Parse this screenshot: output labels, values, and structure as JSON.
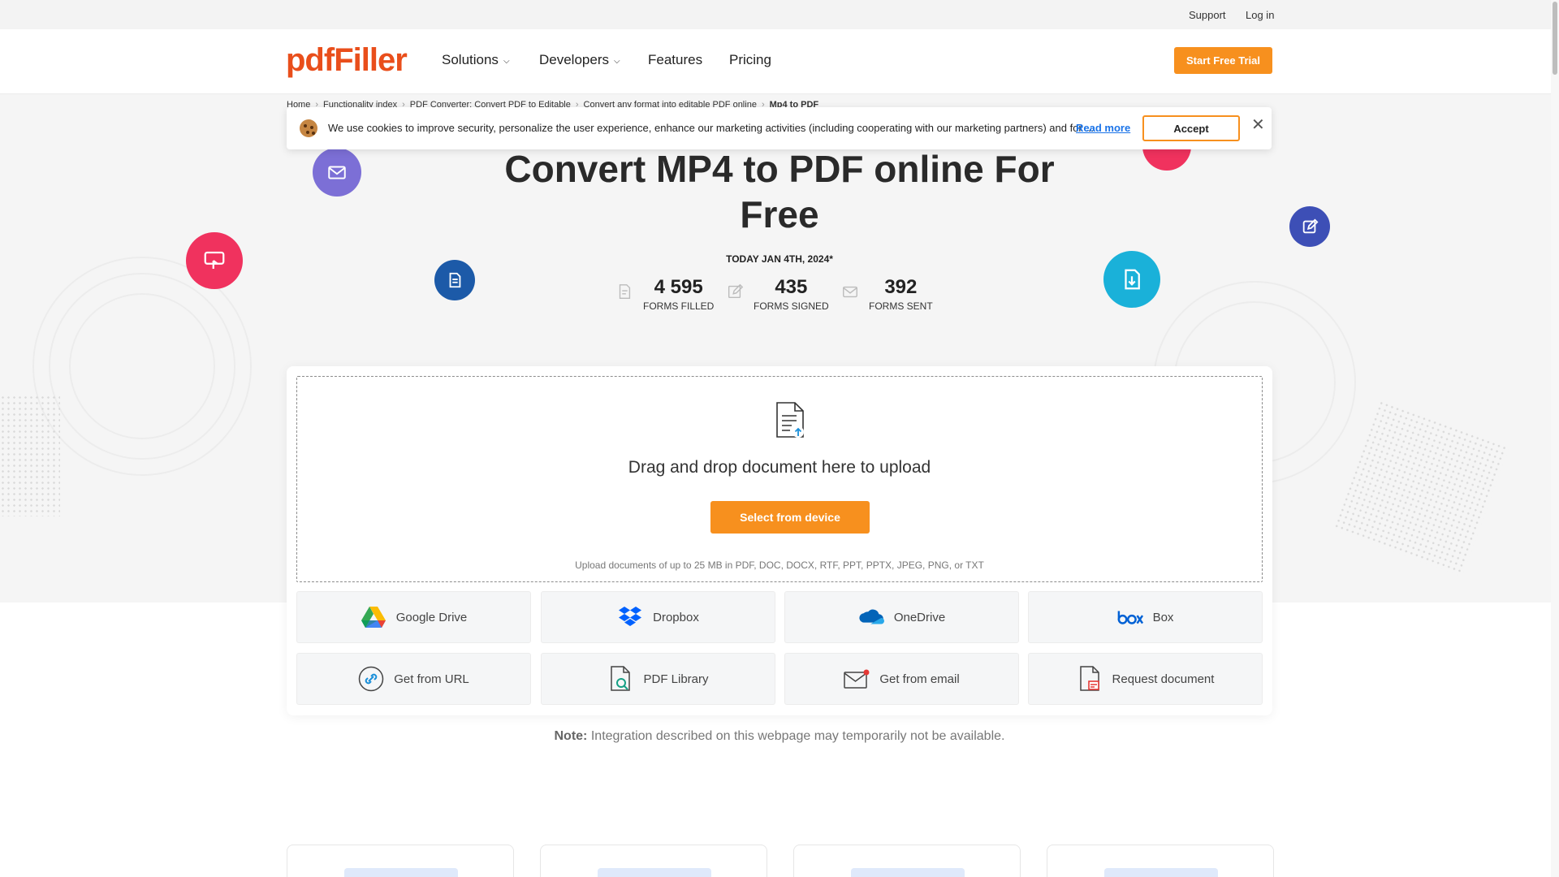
{
  "utility": {
    "support": "Support",
    "login": "Log in"
  },
  "header": {
    "logo": "pdfFiller",
    "nav": [
      {
        "label": "Solutions",
        "dropdown": true
      },
      {
        "label": "Developers",
        "dropdown": true
      },
      {
        "label": "Features",
        "dropdown": false
      },
      {
        "label": "Pricing",
        "dropdown": false
      }
    ],
    "trial_button": "Start Free Trial"
  },
  "breadcrumb": {
    "items": [
      "Home",
      "Functionality index",
      "PDF Converter: Convert PDF to Editable",
      "Convert any format into editable PDF online",
      "Mp4 to PDF"
    ],
    "separator": "›"
  },
  "cookie": {
    "text": "We use cookies to improve security, personalize the user experience, enhance our marketing activities (including cooperating with our marketing partners) and for ...",
    "read_more": "Read more",
    "accept": "Accept",
    "close": "✕"
  },
  "hero": {
    "title": "Convert MP4 to PDF online For Free",
    "date": "TODAY JAN 4TH, 2024*",
    "stats": [
      {
        "value": "4 595",
        "label": "FORMS FILLED",
        "icon": "form-filled-icon"
      },
      {
        "value": "435",
        "label": "FORMS SIGNED",
        "icon": "form-signed-icon"
      },
      {
        "value": "392",
        "label": "FORMS SENT",
        "icon": "form-sent-icon"
      }
    ]
  },
  "upload": {
    "drop_text": "Drag and drop document here to upload",
    "select_button": "Select from device",
    "note": "Upload documents of up to 25 MB in PDF, DOC, DOCX, RTF, PPT, PPTX, JPEG, PNG, or TXT"
  },
  "sources": [
    {
      "label": "Google Drive",
      "icon": "google-drive-icon"
    },
    {
      "label": "Dropbox",
      "icon": "dropbox-icon"
    },
    {
      "label": "OneDrive",
      "icon": "onedrive-icon"
    },
    {
      "label": "Box",
      "icon": "box-icon"
    },
    {
      "label": "Get from URL",
      "icon": "link-icon"
    },
    {
      "label": "PDF Library",
      "icon": "pdf-library-icon"
    },
    {
      "label": "Get from email",
      "icon": "email-icon"
    },
    {
      "label": "Request document",
      "icon": "request-document-icon"
    }
  ],
  "note": {
    "label": "Note:",
    "text": "Integration described on this webpage may temporarily not be available."
  },
  "colors": {
    "brand": "#e94e1b",
    "accent": "#f7901e",
    "link": "#1a73e8"
  }
}
